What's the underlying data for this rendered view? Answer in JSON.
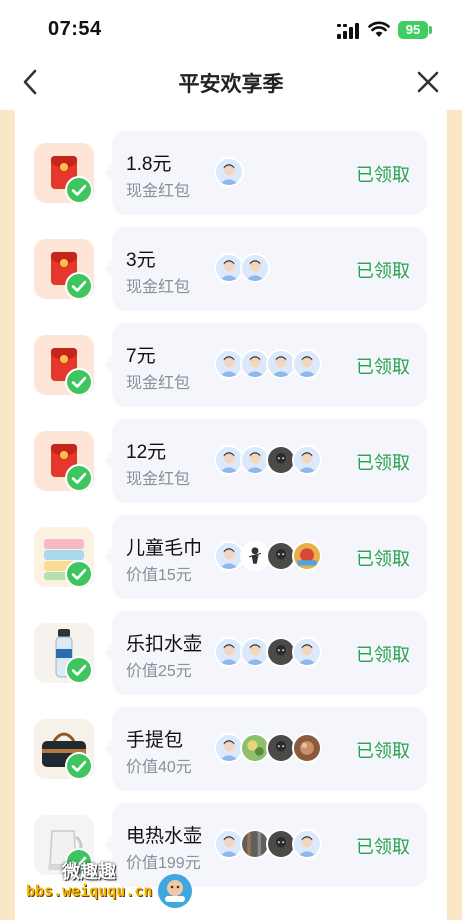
{
  "status_bar": {
    "time": "07:54",
    "battery": "95"
  },
  "nav": {
    "title": "平安欢享季"
  },
  "rewards": [
    {
      "amount": "1.8元",
      "sub": "现金红包",
      "status": "已领取",
      "icon": "red-envelope-icon",
      "avatars": [
        "blue"
      ]
    },
    {
      "amount": "3元",
      "sub": "现金红包",
      "status": "已领取",
      "icon": "red-envelope-icon",
      "avatars": [
        "blue",
        "blue"
      ]
    },
    {
      "amount": "7元",
      "sub": "现金红包",
      "status": "已领取",
      "icon": "red-envelope-icon",
      "avatars": [
        "blue",
        "blue",
        "blue",
        "blue"
      ]
    },
    {
      "amount": "12元",
      "sub": "现金红包",
      "status": "已领取",
      "icon": "red-envelope-icon",
      "avatars": [
        "blue",
        "blue",
        "dark",
        "blue"
      ]
    },
    {
      "amount": "儿童毛巾",
      "sub": "价值15元",
      "status": "已领取",
      "icon": "towel-icon",
      "avatars": [
        "blue",
        "white",
        "dark",
        "colorful"
      ]
    },
    {
      "amount": "乐扣水壶",
      "sub": "价值25元",
      "status": "已领取",
      "icon": "water-bottle-icon",
      "avatars": [
        "blue",
        "blue",
        "dark",
        "blue"
      ]
    },
    {
      "amount": "手提包",
      "sub": "价值40元",
      "status": "已领取",
      "icon": "handbag-icon",
      "avatars": [
        "blue",
        "green",
        "dark",
        "brown"
      ]
    },
    {
      "amount": "电热水壶",
      "sub": "价值199元",
      "status": "已领取",
      "icon": "kettle-icon",
      "avatars": [
        "blue",
        "striped",
        "dark",
        "blue"
      ]
    }
  ],
  "watermark": {
    "line1": "微趣趣",
    "line2": "bbs.weiququ.cn"
  },
  "colors": {
    "accent_green": "#2aa052",
    "badge_green": "#3ec560",
    "card_bg": "#f4f6fb",
    "side_bg": "#fbe7c6"
  }
}
